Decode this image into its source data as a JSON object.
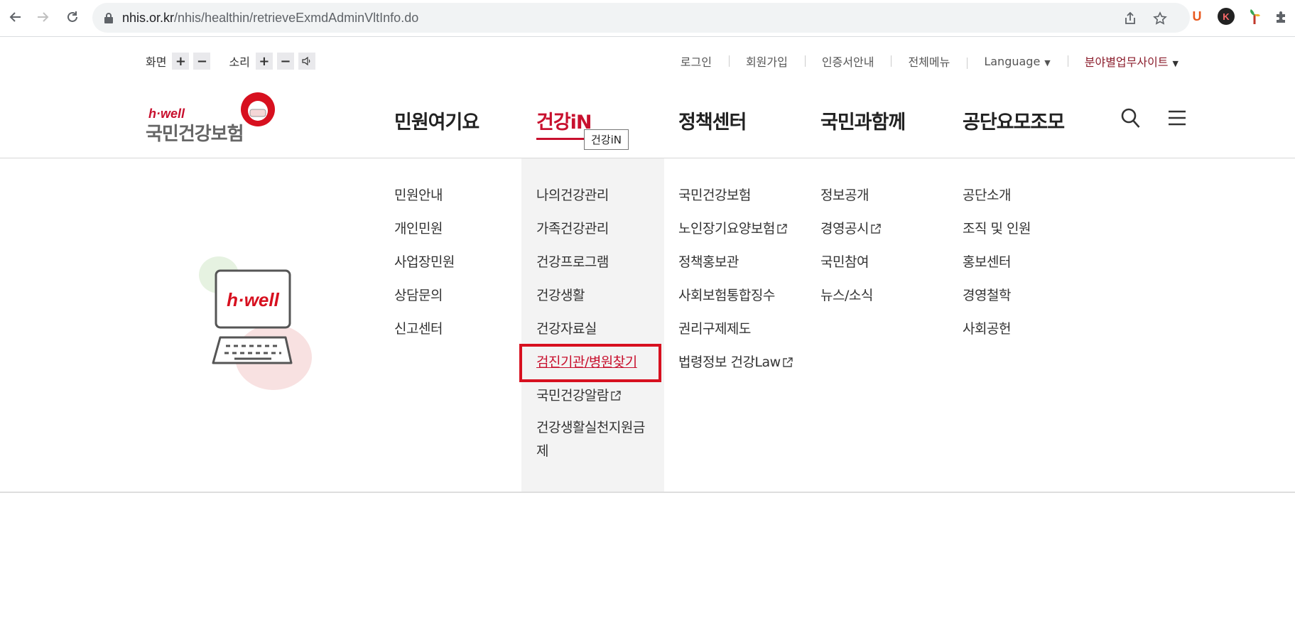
{
  "browser": {
    "url_host": "nhis.or.kr",
    "url_path": "/nhis/healthin/retrieveExmdAdminVltInfo.do",
    "extensions": [
      "U",
      "K"
    ]
  },
  "utility": {
    "screen_label": "화면",
    "sound_label": "소리",
    "plus": "+",
    "minus": "−",
    "links": [
      "로그인",
      "회원가입",
      "인증서안내",
      "전체메뉴",
      "Language",
      "분야별업무사이트"
    ]
  },
  "logo": {
    "hwell": "h·well",
    "name": "국민건강보험"
  },
  "gnb": {
    "items": [
      "민원여기요",
      "건강iN",
      "정책센터",
      "국민과함께",
      "공단요모조모"
    ],
    "active_index": 1,
    "tooltip": "건강iN"
  },
  "illustration": {
    "screen_text": "h·well"
  },
  "menu": {
    "col1": [
      "민원안내",
      "개인민원",
      "사업장민원",
      "상담문의",
      "신고센터"
    ],
    "col2": [
      "나의건강관리",
      "가족건강관리",
      "건강프로그램",
      "건강생활",
      "건강자료실",
      "검진기관/병원찾기",
      "국민건강알람",
      "건강생활실천지원금제"
    ],
    "col3": [
      "국민건강보험",
      "노인장기요양보험",
      "정책홍보관",
      "사회보험통합징수",
      "권리구제제도",
      "법령정보 건강Law"
    ],
    "col4": [
      "정보공개",
      "경영공시",
      "국민참여",
      "뉴스/소식"
    ],
    "col5": [
      "공단소개",
      "조직 및 인원",
      "홍보센터",
      "경영철학",
      "사회공헌"
    ]
  },
  "colors": {
    "brand_red": "#c8102e",
    "highlight_box": "#d7101f",
    "site_link_red": "#8b1d2c"
  }
}
